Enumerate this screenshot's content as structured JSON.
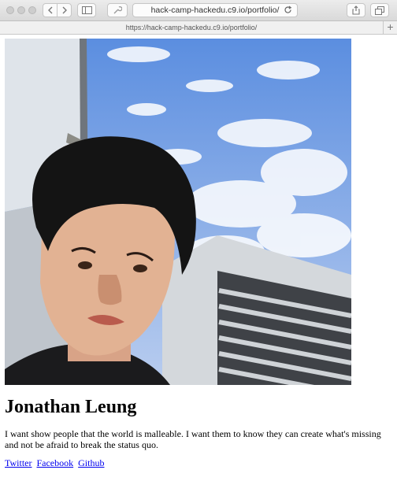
{
  "browser": {
    "address": "hack-camp-hackedu.c9.io/portfolio/",
    "tab_url": "https://hack-camp-hackedu.c9.io/portfolio/",
    "new_tab": "+"
  },
  "profile": {
    "name": "Jonathan Leung",
    "bio": "I want show people that the world is malleable. I want them to know they can create what's missing and not be afraid to break the status quo.",
    "links": [
      "Twitter",
      "Facebook",
      "Github"
    ]
  }
}
